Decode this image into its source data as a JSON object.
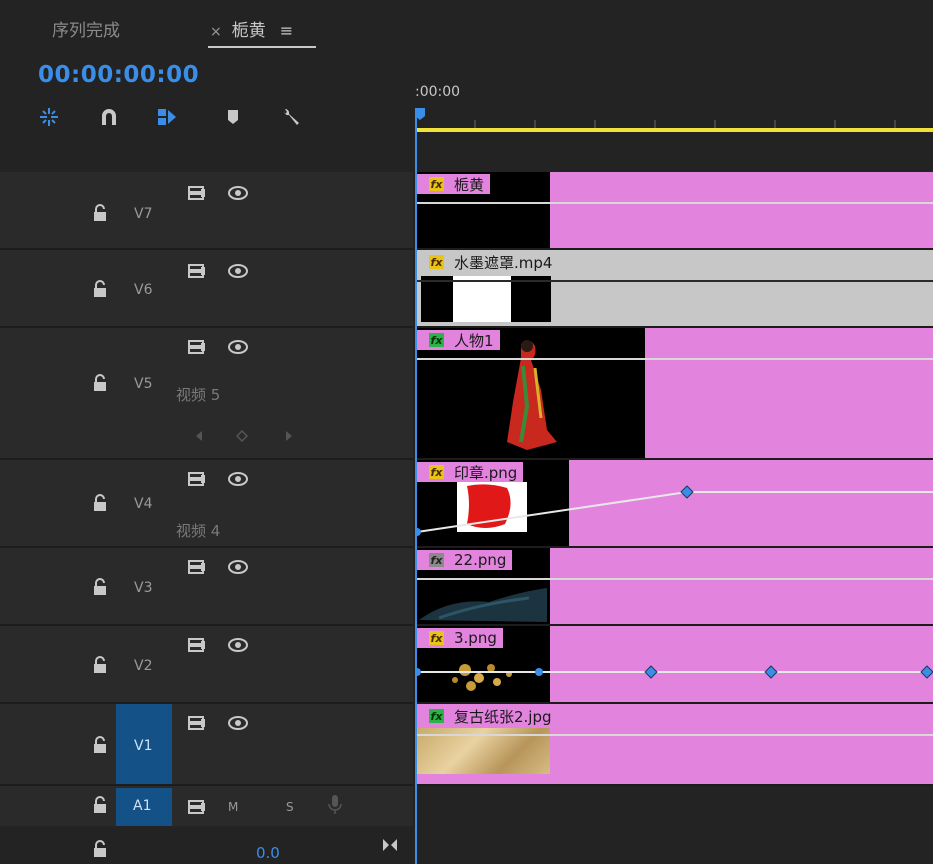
{
  "tabs": {
    "sequence_tab": "序列完成",
    "active_close": "×",
    "active_tab": "栀黄",
    "active_menu": "≡"
  },
  "timeline": {
    "timecode": "00:00:00:00",
    "ruler_start": ":00:00",
    "accent_color": "#3a8ee8",
    "clip_color": "#e283de"
  },
  "tools": [
    "nest-icon",
    "snap-icon",
    "linked-selection-icon",
    "add-marker-icon",
    "settings-wrench-icon"
  ],
  "tracks": {
    "v7": {
      "label": "V7",
      "clip": "栀黄"
    },
    "v6": {
      "label": "V6",
      "clip": "水墨遮罩.mp4"
    },
    "v5": {
      "label": "V5",
      "name": "视频 5",
      "clip": "人物1"
    },
    "v4": {
      "label": "V4",
      "name": "视频 4",
      "clip": "印章.png"
    },
    "v3": {
      "label": "V3",
      "clip": "22.png"
    },
    "v2": {
      "label": "V2",
      "clip": "3.png"
    },
    "v1": {
      "label": "V1",
      "clip": "复古纸张2.jpg"
    },
    "a1": {
      "label": "A1",
      "mute": "M",
      "solo": "S"
    }
  },
  "master": {
    "volume": "0.0"
  }
}
